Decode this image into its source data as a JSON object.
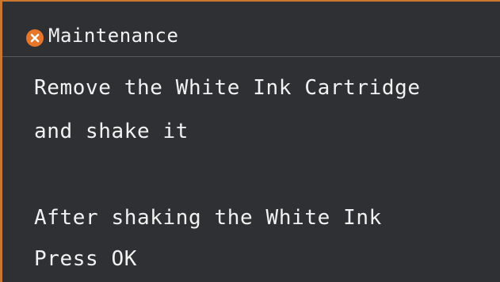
{
  "header": {
    "icon": "error-x-icon",
    "title": "Maintenance"
  },
  "message": {
    "line1": "Remove the White Ink Cartridge",
    "line2": "and shake it",
    "line3": "After shaking the White Ink",
    "line4": "Press OK"
  },
  "colors": {
    "background": "#2f3033",
    "frame_border": "#c9782e",
    "error_icon": "#e8762a",
    "text": "#f2f2f2",
    "divider": "#55575b"
  }
}
